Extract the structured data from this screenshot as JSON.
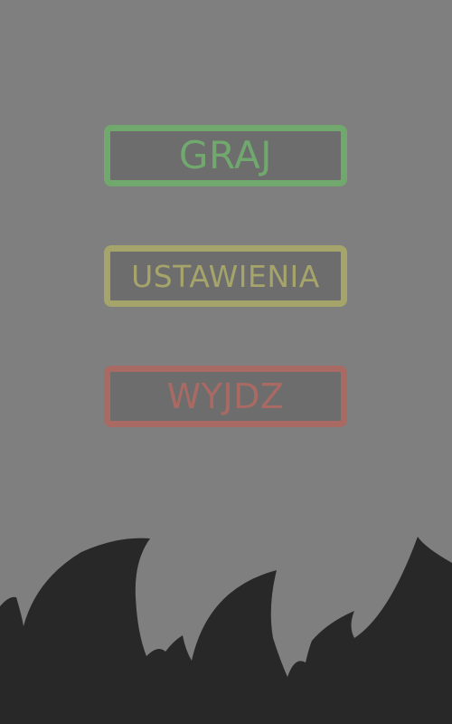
{
  "menu": {
    "play_label": "GRAJ",
    "settings_label": "USTAWIENIA",
    "exit_label": "WYJDZ"
  },
  "colors": {
    "background": "#7f7f7f",
    "button_fill": "#6d6d6d",
    "play": "#70a86e",
    "settings": "#a5a46a",
    "exit": "#a96a64",
    "flames": "#282828"
  }
}
